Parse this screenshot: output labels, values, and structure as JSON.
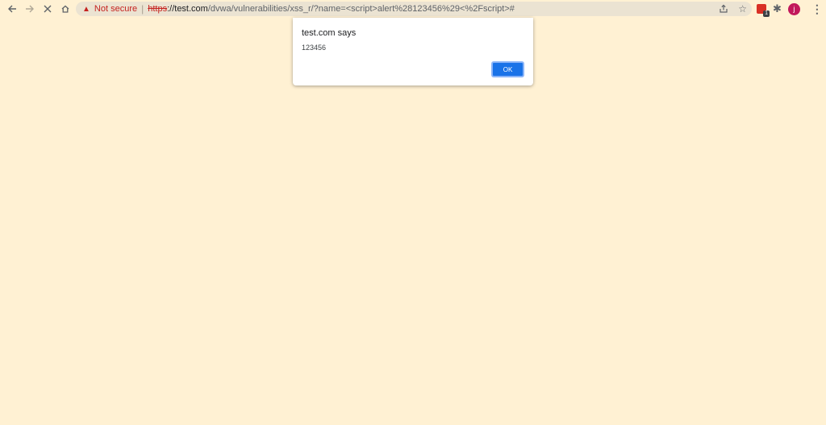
{
  "browser": {
    "nav": {
      "back_icon": "arrow-left-icon",
      "forward_icon": "arrow-right-icon",
      "stop_icon": "close-icon",
      "home_icon": "home-icon"
    },
    "omnibox": {
      "security_label": "Not secure",
      "separator": "|",
      "scheme": "https",
      "url_host": "://test.com",
      "url_rest": "/dvwa/vulnerabilities/xss_r/?name=<script>alert%28123456%29<%2Fscript>#"
    },
    "extensions": {
      "badge": "1",
      "avatar_initial": "j"
    }
  },
  "dialog": {
    "title": "test.com says",
    "message": "123456",
    "ok_label": "OK"
  },
  "colors": {
    "page_background": "#fff1d3",
    "ok_button": "#1a73e8",
    "not_secure": "#c5221f"
  }
}
